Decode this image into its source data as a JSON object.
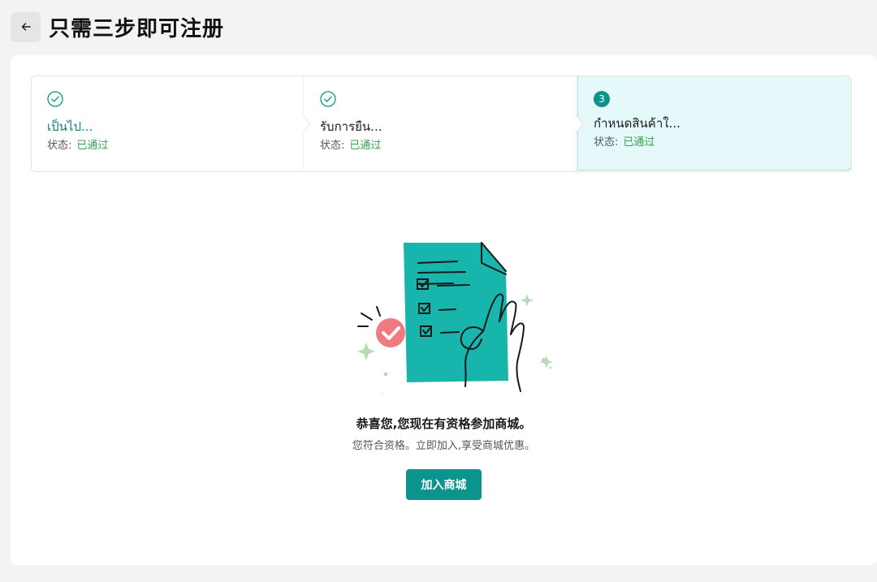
{
  "header": {
    "title": "只需三步即可注册"
  },
  "steps": [
    {
      "title": "เป็นไป...",
      "status_label": "状态:",
      "status_value": "已通过",
      "state": "done"
    },
    {
      "title": "รับการยืน...",
      "status_label": "状态:",
      "status_value": "已通过",
      "state": "done"
    },
    {
      "number": "3",
      "title": "กำหนดสินค้าใ...",
      "status_label": "状态:",
      "status_value": "已通过",
      "state": "active"
    }
  ],
  "result": {
    "headline": "恭喜您,您现在有资格参加商城。",
    "subtext": "您符合资格。立即加入,享受商城优惠。",
    "button_label": "加入商城"
  },
  "colors": {
    "accent": "#0b948e",
    "success_text": "#3aa052",
    "active_step_bg": "#e5f8fa",
    "check_badge": "#f07a82",
    "sparkle": "#b7dcb5"
  }
}
